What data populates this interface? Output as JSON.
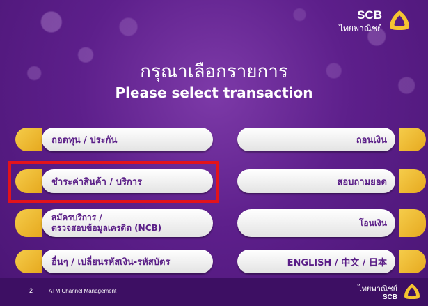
{
  "brand": {
    "name": "SCB",
    "thai_name": "ไทยพาณิชย์",
    "logo_icon": "scb-bell-icon",
    "accent": "#f5c430"
  },
  "header": {
    "title_th": "กรุณาเลือกรายการ",
    "title_en": "Please select transaction"
  },
  "left_buttons": [
    {
      "label": "ถอดทุน / ประกัน"
    },
    {
      "label": "ชำระค่าสินค้า / บริการ"
    },
    {
      "label_line1": "สมัครบริการ /",
      "label_line2": "ตรวจสอบข้อมูลเครดิต (NCB)"
    },
    {
      "label": "อื่นๆ / เปลี่ยนรหัสเงิน-รหัสบัตร"
    }
  ],
  "right_buttons": [
    {
      "label": "ถอนเงิน"
    },
    {
      "label": "สอบถามยอด"
    },
    {
      "label": "โอนเงิน"
    },
    {
      "label": "ENGLISH / 中文 / 日本"
    }
  ],
  "footer": {
    "page_number": "2",
    "department": "ATM Channel Management",
    "thai_name": "ไทยพาณิชย์",
    "name": "SCB"
  },
  "colors": {
    "background": "#5d1f8b",
    "button_text": "#5a1e87",
    "highlight": "#e3131b",
    "tab": "#f5cc4a"
  }
}
